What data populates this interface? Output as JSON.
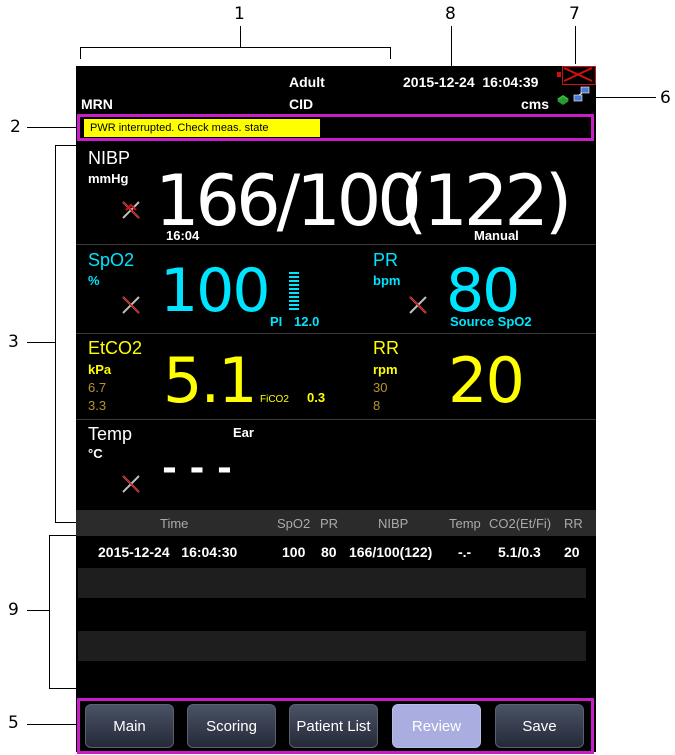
{
  "callouts": [
    "1",
    "8",
    "7",
    "6",
    "2",
    "3",
    "9",
    "5"
  ],
  "header": {
    "patient_type": "Adult",
    "datetime": "2015-12-24  16:04:39",
    "mrn_label": "MRN",
    "cid_label": "CID",
    "network_label": "cms"
  },
  "alarm_message": "PWR interrupted. Check meas. state",
  "nibp": {
    "label": "NIBP",
    "unit": "mmHg",
    "value": "166/100",
    "mean": "(122)",
    "time": "16:04",
    "mode": "Manual"
  },
  "spo2": {
    "label": "SpO2",
    "unit": "%",
    "value": "100",
    "pi_label": "PI",
    "pi_value": "12.0"
  },
  "pr": {
    "label": "PR",
    "unit": "bpm",
    "value": "80",
    "source": "Source SpO2"
  },
  "etco2": {
    "label": "EtCO2",
    "unit": "kPa",
    "high_limit": "6.7",
    "low_limit": "3.3",
    "value": "5.1",
    "fico2_label": "FiCO2",
    "fico2_value": "0.3"
  },
  "rr": {
    "label": "RR",
    "unit": "rpm",
    "high_limit": "30",
    "low_limit": "8",
    "value": "20"
  },
  "temp": {
    "label": "Temp",
    "unit": "°C",
    "site": "Ear",
    "value": "- - -"
  },
  "table": {
    "headers": [
      "Time",
      "SpO2",
      "PR",
      "NIBP",
      "Temp",
      "CO2(Et/Fi)",
      "RR"
    ],
    "rows": [
      {
        "time": "2015-12-24   16:04:30",
        "spo2": "100",
        "pr": "80",
        "nibp": "166/100(122)",
        "temp": "-.-",
        "co2": "5.1/0.3",
        "rr": "20"
      }
    ]
  },
  "buttons": [
    "Main",
    "Scoring",
    "Patient List",
    "Review",
    "Save"
  ],
  "colors": {
    "spo2": "#00e5ff",
    "etco2": "#ffff00",
    "limits": "#b8932a",
    "alarm_bg": "#ffff00",
    "callout_box": "#c81ec8",
    "active_button": "#a9addf"
  }
}
